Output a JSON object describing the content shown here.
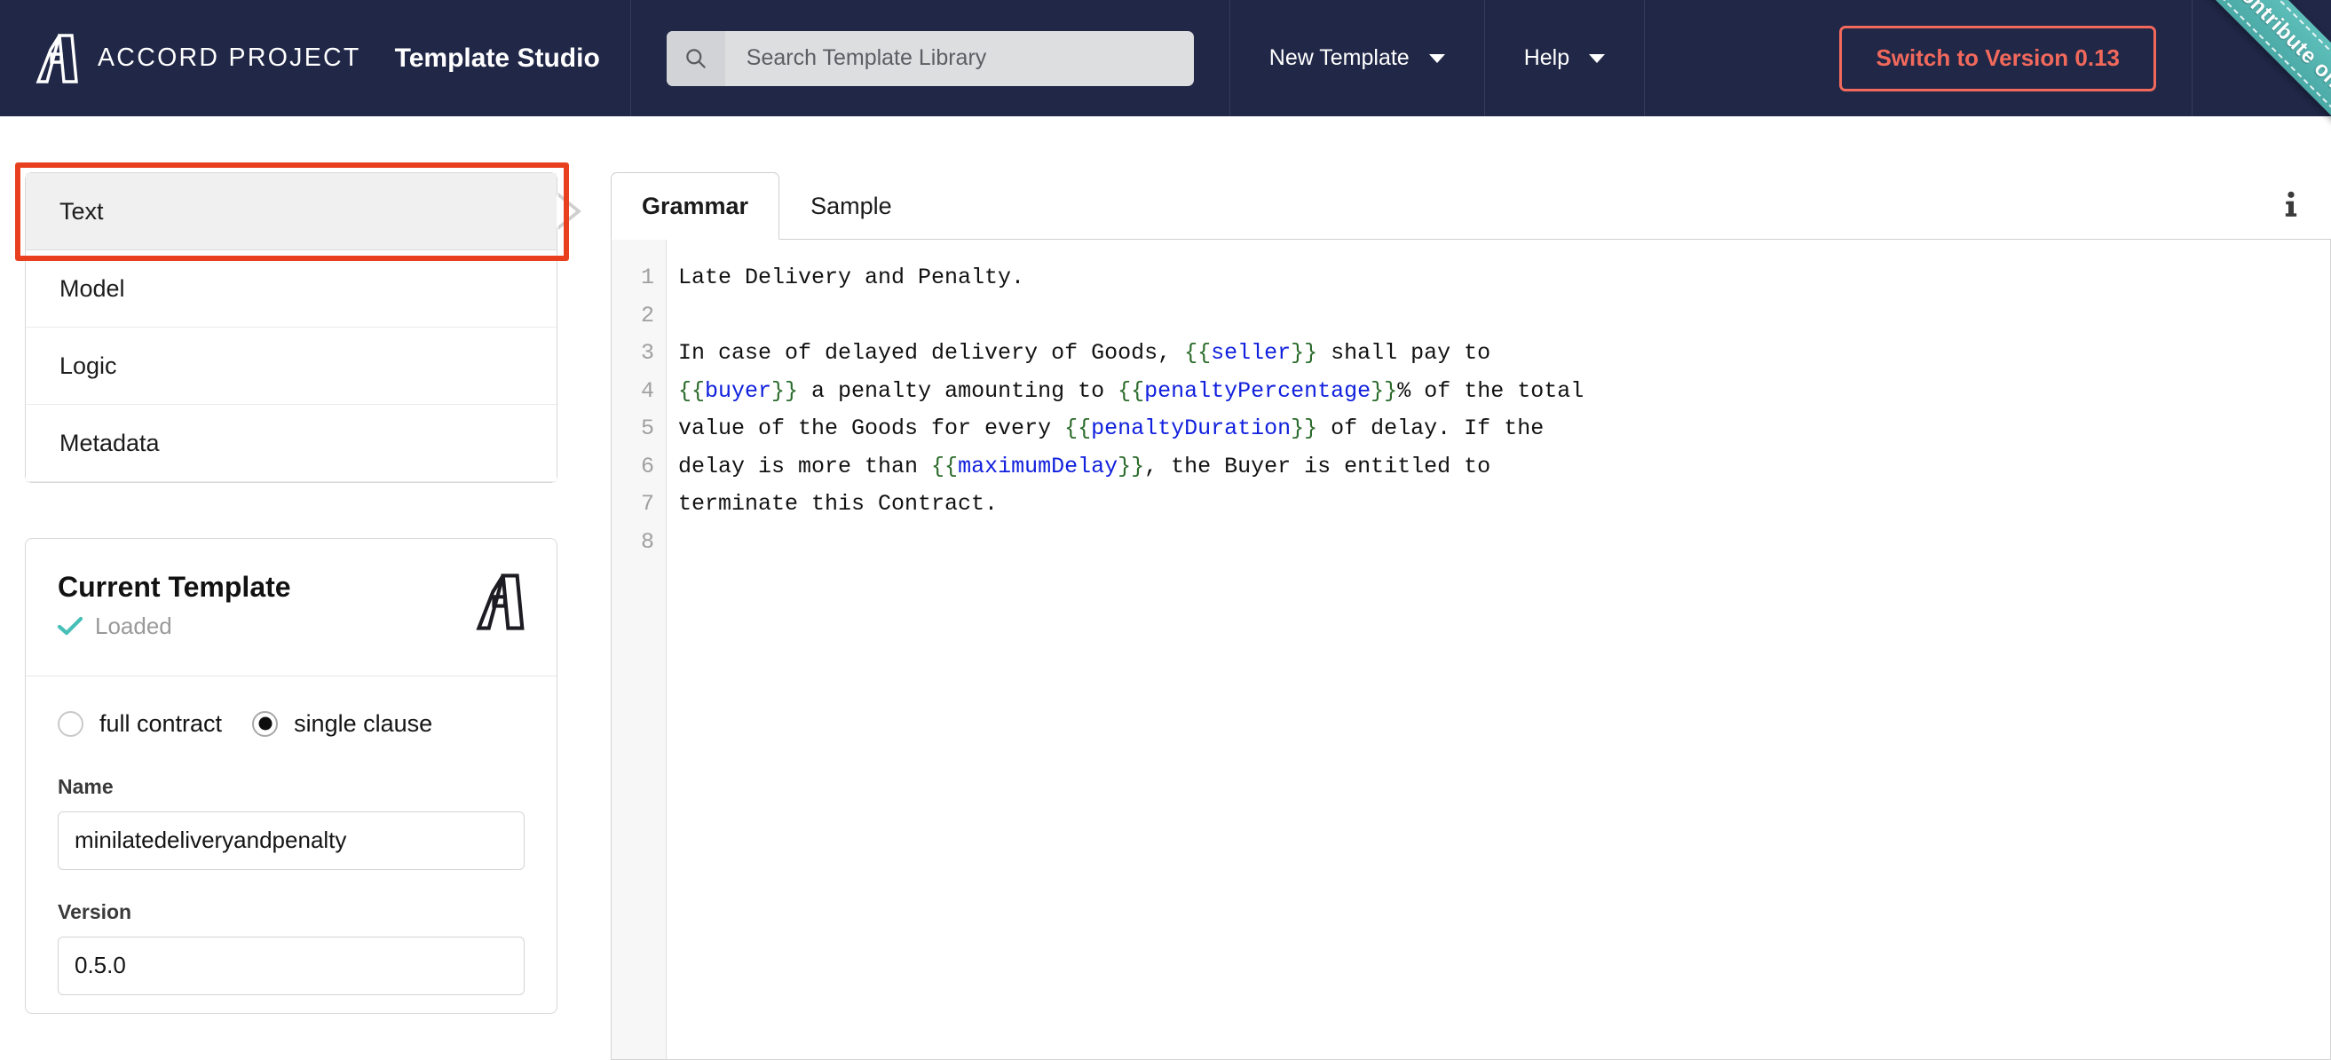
{
  "header": {
    "brand_name": "ACCORD PROJECT",
    "app_title": "Template Studio",
    "search": {
      "placeholder": "Search Template Library",
      "value": "",
      "icon": "search-icon"
    },
    "nav": [
      {
        "label": "New Template",
        "has_caret": true
      },
      {
        "label": "Help",
        "has_caret": true
      }
    ],
    "switch_version_label": "Switch to Version 0.13",
    "colors": {
      "header_bg": "#202747",
      "accent_coral": "#f2695c",
      "ribbon_teal": "#5fc0bb",
      "annotation_red": "#e8401f",
      "check_teal": "#45bfb8"
    }
  },
  "ribbon": {
    "label": "Contribute on GitHub"
  },
  "sidebar": {
    "menu_items": [
      {
        "label": "Text",
        "active": true
      },
      {
        "label": "Model",
        "active": false
      },
      {
        "label": "Logic",
        "active": false
      },
      {
        "label": "Metadata",
        "active": false
      }
    ],
    "current_template": {
      "title": "Current Template",
      "status": "Loaded",
      "status_icon": "check-icon",
      "logo_icon": "accord-logo-icon",
      "radio_options": [
        {
          "label": "full contract",
          "checked": false
        },
        {
          "label": "single clause",
          "checked": true
        }
      ],
      "fields": [
        {
          "label": "Name",
          "value": "minilatedeliveryandpenalty"
        },
        {
          "label": "Version",
          "value": "0.5.0"
        }
      ]
    }
  },
  "editor": {
    "tabs": [
      {
        "label": "Grammar",
        "active": true
      },
      {
        "label": "Sample",
        "active": false
      }
    ],
    "info_icon": "info-icon",
    "line_numbers": [
      "1",
      "2",
      "3",
      "4",
      "5",
      "6",
      "7",
      "8"
    ],
    "lines": [
      [
        {
          "t": "plain",
          "s": "Late Delivery and Penalty."
        }
      ],
      [
        {
          "t": "plain",
          "s": ""
        }
      ],
      [
        {
          "t": "plain",
          "s": "In case of delayed delivery of Goods, "
        },
        {
          "t": "brace",
          "s": "{{"
        },
        {
          "t": "var",
          "s": "seller"
        },
        {
          "t": "brace",
          "s": "}}"
        },
        {
          "t": "plain",
          "s": " shall pay to"
        }
      ],
      [
        {
          "t": "brace",
          "s": "{{"
        },
        {
          "t": "var",
          "s": "buyer"
        },
        {
          "t": "brace",
          "s": "}}"
        },
        {
          "t": "plain",
          "s": " a penalty amounting to "
        },
        {
          "t": "brace",
          "s": "{{"
        },
        {
          "t": "var",
          "s": "penaltyPercentage"
        },
        {
          "t": "brace",
          "s": "}}"
        },
        {
          "t": "plain",
          "s": "% of the total"
        }
      ],
      [
        {
          "t": "plain",
          "s": "value of the Goods for every "
        },
        {
          "t": "brace",
          "s": "{{"
        },
        {
          "t": "var",
          "s": "penaltyDuration"
        },
        {
          "t": "brace",
          "s": "}}"
        },
        {
          "t": "plain",
          "s": " of delay. If the"
        }
      ],
      [
        {
          "t": "plain",
          "s": "delay is more than "
        },
        {
          "t": "brace",
          "s": "{{"
        },
        {
          "t": "var",
          "s": "maximumDelay"
        },
        {
          "t": "brace",
          "s": "}}"
        },
        {
          "t": "plain",
          "s": ", the Buyer is entitled to"
        }
      ],
      [
        {
          "t": "plain",
          "s": "terminate this Contract."
        }
      ],
      [
        {
          "t": "plain",
          "s": ""
        }
      ]
    ]
  }
}
